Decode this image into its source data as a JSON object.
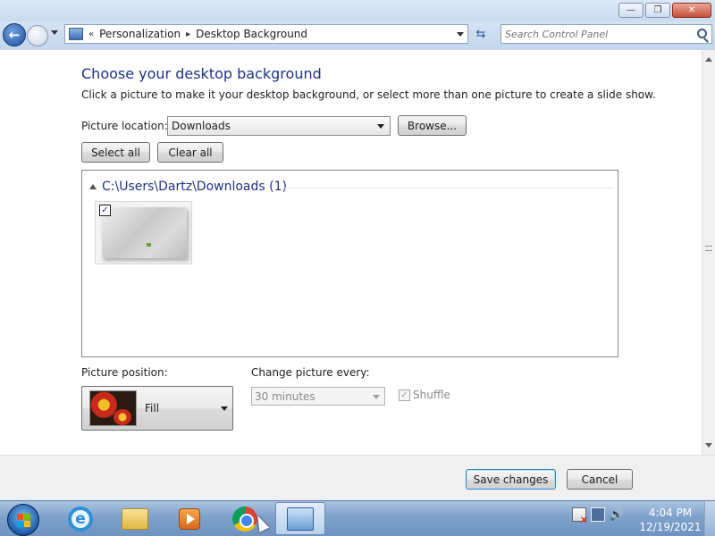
{
  "window": {
    "minimize_glyph": "—",
    "restore_glyph": "❐",
    "close_glyph": "✕"
  },
  "address_bar": {
    "nav_overflow": "«",
    "breadcrumbs": [
      "Personalization",
      "Desktop Background"
    ],
    "separator": "▸",
    "refresh_glyph": "⇆",
    "search_placeholder": "Search Control Panel"
  },
  "page": {
    "heading": "Choose your desktop background",
    "instructions": "Click a picture to make it your desktop background, or select more than one picture to create a slide show.",
    "picture_location_label": "Picture location:",
    "picture_location_value": "Downloads",
    "browse_label": "Browse...",
    "select_all_label": "Select all",
    "clear_all_label": "Clear all",
    "gallery": {
      "group_title": "C:\\Users\\Dartz\\Downloads (1)",
      "thumbnail_checked": true,
      "check_glyph": "✓"
    },
    "picture_position_label": "Picture position:",
    "picture_position_value": "Fill",
    "change_every_label": "Change picture every:",
    "change_every_value": "30 minutes",
    "shuffle_label": "Shuffle",
    "shuffle_glyph": "✓"
  },
  "footer": {
    "save_label": "Save changes",
    "cancel_label": "Cancel"
  },
  "taskbar": {
    "items": [
      "start-orb",
      "internet-explorer",
      "windows-explorer",
      "windows-media-player",
      "google-chrome",
      "control-panel"
    ],
    "ie_glyph": "e",
    "volume_glyph": "🔊",
    "clock_time": "4:04 PM",
    "clock_date": "12/19/2021"
  },
  "colors": {
    "heading_blue": "#1e3287",
    "taskbar": "#7fa2cc"
  }
}
